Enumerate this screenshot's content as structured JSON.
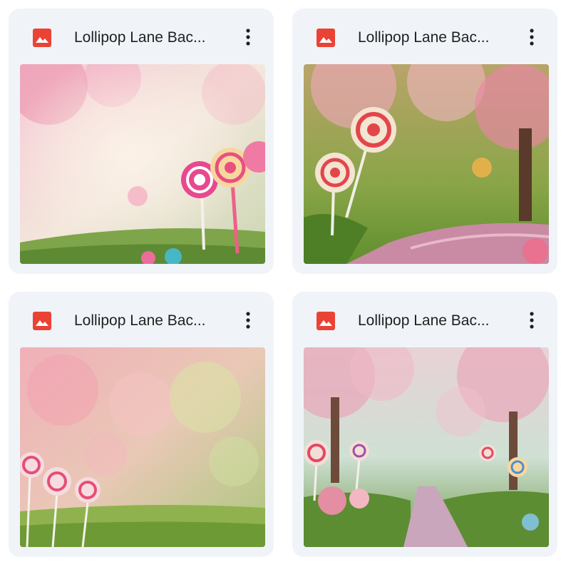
{
  "files": [
    {
      "title": "Lollipop Lane Bac...",
      "icon": "image-file-icon",
      "menu_icon": "more-vert-icon"
    },
    {
      "title": "Lollipop Lane Bac...",
      "icon": "image-file-icon",
      "menu_icon": "more-vert-icon"
    },
    {
      "title": "Lollipop Lane Bac...",
      "icon": "image-file-icon",
      "menu_icon": "more-vert-icon"
    },
    {
      "title": "Lollipop Lane Bac...",
      "icon": "image-file-icon",
      "menu_icon": "more-vert-icon"
    }
  ],
  "colors": {
    "card_bg": "#f0f4f9",
    "icon_red": "#ea4335",
    "title_text": "#1f1f1f"
  }
}
